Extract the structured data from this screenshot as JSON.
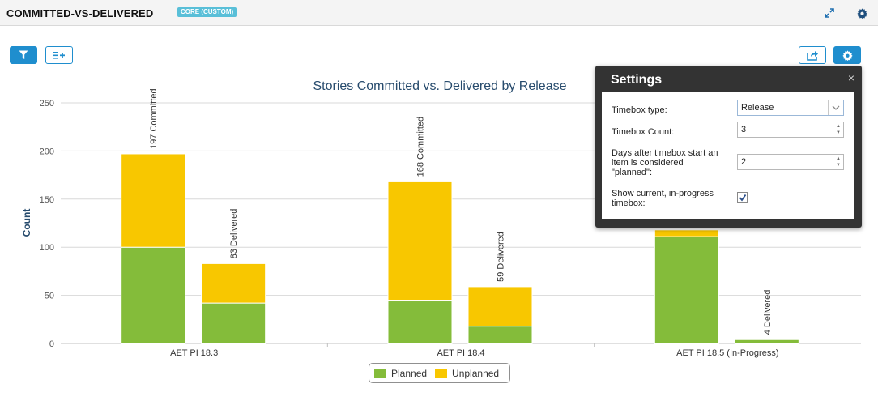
{
  "header": {
    "title": "COMMITTED-VS-DELIVERED",
    "badge": "CORE (CUSTOM)",
    "icons": [
      "expand-icon",
      "gear-icon"
    ]
  },
  "toolbar": {
    "left_icons": [
      "filter-icon",
      "add-list-icon"
    ],
    "right_icons": [
      "export-icon",
      "gear-icon"
    ]
  },
  "colors": {
    "accent": "#1f8ece",
    "planned": "#84bc3a",
    "unplanned": "#f8c700",
    "badge": "#59bfd8",
    "settings_bg": "#333333"
  },
  "chart_data": {
    "type": "bar",
    "title": "Stories Committed vs. Delivered by Release",
    "ylabel": "Count",
    "xlabel": "",
    "ylim": [
      0,
      250
    ],
    "yticks": [
      0,
      50,
      100,
      150,
      200,
      250
    ],
    "grid": true,
    "stacked": true,
    "categories": [
      "AET PI 18.3",
      "AET PI 18.4",
      "AET PI 18.5 (In-Progress)"
    ],
    "bars": [
      {
        "category": "AET PI 18.3",
        "kind": "committed",
        "planned": 100,
        "unplanned": 97,
        "label": "197 Committed"
      },
      {
        "category": "AET PI 18.3",
        "kind": "delivered",
        "planned": 42,
        "unplanned": 41,
        "label": "83 Delivered"
      },
      {
        "category": "AET PI 18.4",
        "kind": "committed",
        "planned": 45,
        "unplanned": 123,
        "label": "168 Committed"
      },
      {
        "category": "AET PI 18.4",
        "kind": "delivered",
        "planned": 18,
        "unplanned": 41,
        "label": "59 Delivered"
      },
      {
        "category": "AET PI 18.5 (In-Progress)",
        "kind": "committed",
        "planned": 111,
        "unplanned": 7,
        "label": ""
      },
      {
        "category": "AET PI 18.5 (In-Progress)",
        "kind": "delivered",
        "planned": 4,
        "unplanned": 0,
        "label": "4 Delivered"
      }
    ],
    "legend": {
      "position": "bottom-center",
      "entries": [
        "Planned",
        "Unplanned"
      ]
    }
  },
  "settings": {
    "title": "Settings",
    "close_label": "×",
    "timebox_type_label": "Timebox type:",
    "timebox_type_value": "Release",
    "timebox_count_label": "Timebox Count:",
    "timebox_count_value": "3",
    "days_label_lines": [
      "Days after timebox start an",
      "item is considered",
      "\"planned\":"
    ],
    "days_value": "2",
    "show_current_label_lines": [
      "Show current, in-progress",
      "timebox:"
    ],
    "show_current_checked": true
  }
}
